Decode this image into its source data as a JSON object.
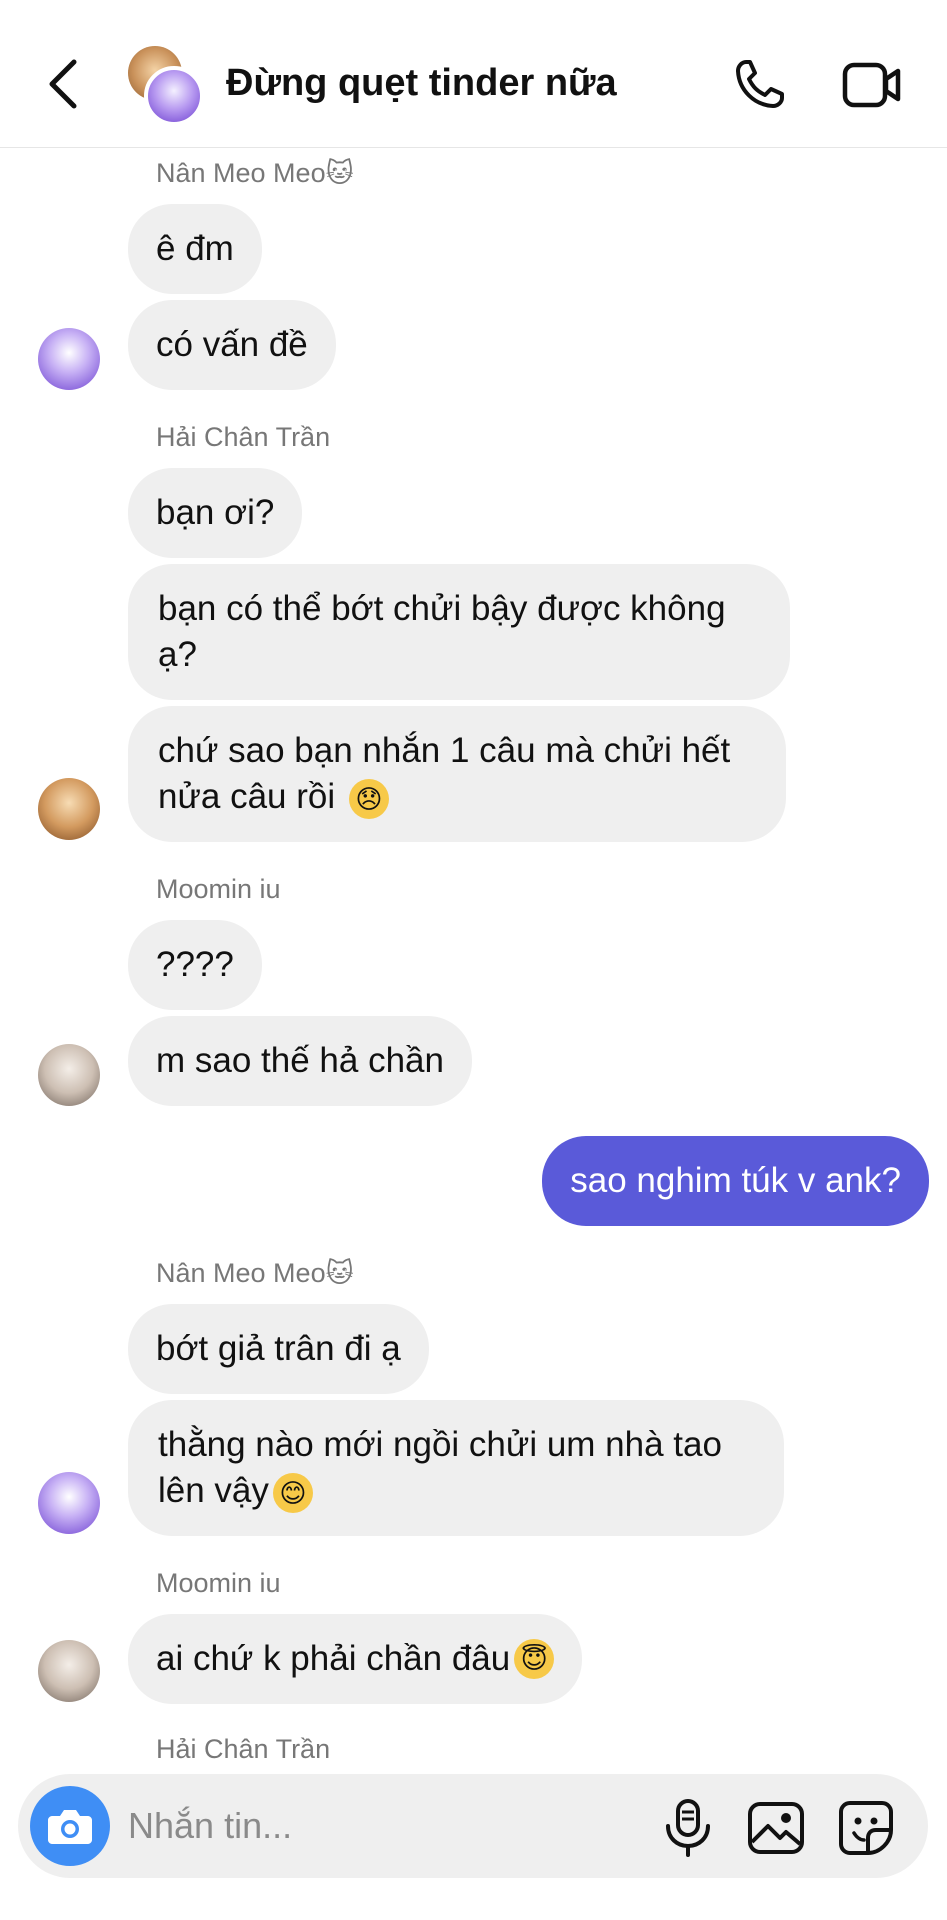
{
  "header": {
    "title": "Đừng quẹt tinder nữa"
  },
  "messages": {
    "g1": {
      "sender": "Nân Meo Meo🐱",
      "b1": "ê đm",
      "b2": "có vấn đề"
    },
    "g2": {
      "sender": "Hải Chân Trần",
      "b1": "bạn ơi?",
      "b2_l1": "bạn có thể bớt chửi bậy được không",
      "b2_l2": "ạ?",
      "b3_l1": "chứ sao bạn nhắn 1 câu mà chửi hết",
      "b3_l2": "nửa câu rồi ",
      "b3_emoji": "😞"
    },
    "g3": {
      "sender": "Moomin iu",
      "b1": "????",
      "b2": "m sao thế hả chần"
    },
    "me": {
      "b1": "sao nghim túk v ank?"
    },
    "g4": {
      "sender": "Nân Meo Meo🐱",
      "b1": "bớt giả trân đi ạ",
      "b2_l1": "thằng nào mới ngồi chửi um nhà tao",
      "b2_l2": "lên vậy",
      "b2_emoji": "😊"
    },
    "g5": {
      "sender": "Moomin iu",
      "b1": "ai chứ k phải chần đâu",
      "b1_emoji": "😇"
    },
    "g6": {
      "sender": "Hải Chân Trần"
    }
  },
  "composer": {
    "placeholder": "Nhắn tin..."
  },
  "colors": {
    "my_bubble": "#5a5ad9",
    "other_bubble": "#efefef",
    "camera_button": "#3f8ef5"
  },
  "icons": [
    "back-chevron-icon",
    "phone-icon",
    "video-call-icon",
    "camera-icon",
    "microphone-icon",
    "gallery-icon",
    "sticker-icon"
  ]
}
